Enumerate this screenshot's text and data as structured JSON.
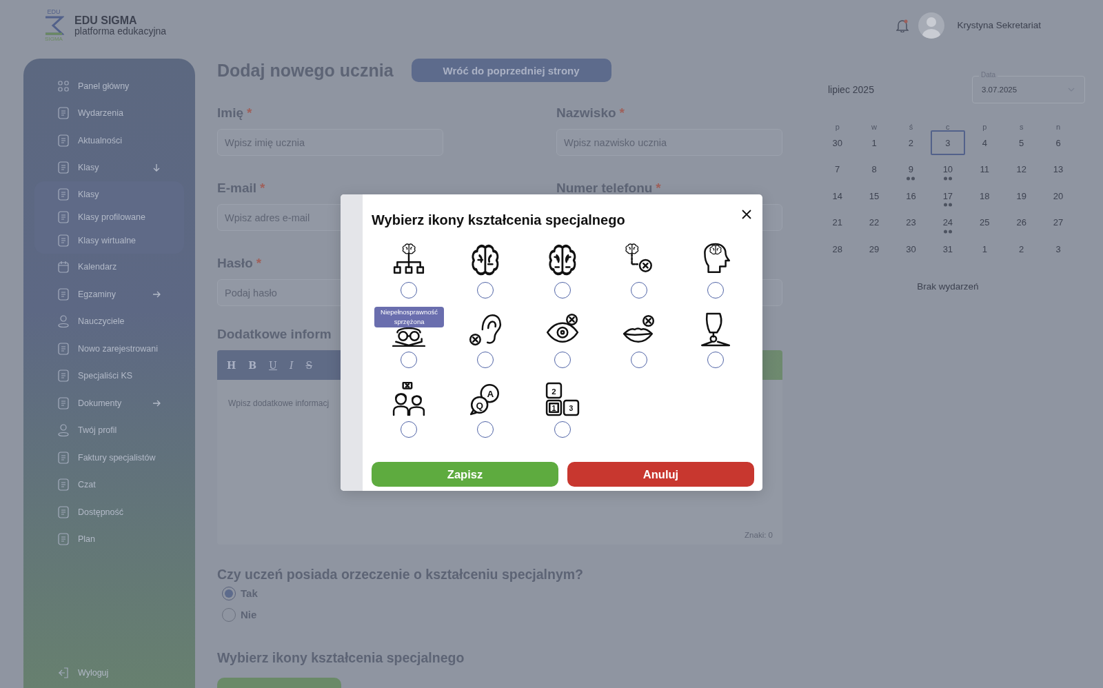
{
  "brand": {
    "logo_top": "EDU",
    "logo_bottom": "SIGMA",
    "name": "EDU SIGMA",
    "tagline": "platforma edukacyjna"
  },
  "user": {
    "name": "Krystyna Sekretariat"
  },
  "sidebar": {
    "items": [
      {
        "label": "Panel główny",
        "kind": "grid"
      },
      {
        "label": "Wydarzenia",
        "kind": "doc"
      },
      {
        "label": "Aktualności",
        "kind": "doc"
      },
      {
        "label": "Klasy",
        "kind": "doc",
        "expanded": true,
        "children": [
          {
            "label": "Klasy",
            "kind": "doc"
          },
          {
            "label": "Klasy profilowane",
            "kind": "doc"
          },
          {
            "label": "Klasy wirtualne",
            "kind": "doc"
          }
        ]
      },
      {
        "label": "Kalendarz",
        "kind": "calendar"
      },
      {
        "label": "Egzaminy",
        "kind": "doc",
        "expanded": false
      },
      {
        "label": "Nauczyciele",
        "kind": "person"
      },
      {
        "label": "Nowo zarejestrowani",
        "kind": "doc"
      },
      {
        "label": "Specjaliści KS",
        "kind": "doc"
      },
      {
        "label": "Dokumenty",
        "kind": "doc",
        "expanded": false
      },
      {
        "label": "Twój profil",
        "kind": "person"
      },
      {
        "label": "Faktury specjalistów",
        "kind": "doc"
      },
      {
        "label": "Czat",
        "kind": "doc"
      },
      {
        "label": "Dostępność",
        "kind": "doc"
      },
      {
        "label": "Plan",
        "kind": "doc"
      }
    ],
    "logout": {
      "label": "Wyloguj"
    }
  },
  "page": {
    "title": "Dodaj nowego ucznia",
    "back_button": "Wróć do poprzedniej strony",
    "fields": [
      {
        "label": "Imię",
        "required": true,
        "placeholder": "Wpisz imię ucznia"
      },
      {
        "label": "Nazwisko",
        "required": true,
        "placeholder": "Wpisz nazwisko ucznia"
      },
      {
        "label": "E-mail",
        "required": true,
        "placeholder": "Wpisz adres e-mail"
      },
      {
        "label": "Numer telefonu",
        "required": true
      },
      {
        "label": "Hasło",
        "required": true,
        "placeholder": "Podaj hasło"
      }
    ],
    "required_mark": "*",
    "editor": {
      "label": "Dodatkowe inform",
      "tools": [
        {
          "label": "H",
          "kind": "heading"
        },
        {
          "label": "B",
          "kind": "bold"
        },
        {
          "label": "U",
          "kind": "underline"
        },
        {
          "label": "I",
          "kind": "italic"
        },
        {
          "label": "S",
          "kind": "strike"
        }
      ],
      "placeholder": "Wpisz dodatkowe informacj",
      "counter": "Znaki: 0"
    },
    "question": "Czy uczeń posiada orzeczenie o kształceniu specjalnym?",
    "options": [
      {
        "label": "Tak",
        "selected": true
      },
      {
        "label": "Nie",
        "selected": false
      }
    ],
    "icons_heading": "Wybierz ikony kształcenia specjalnego"
  },
  "calendar": {
    "month": "lipiec 2025",
    "date_field": {
      "label": "Data",
      "value": "3.07.2025"
    },
    "weekdays": [
      "p",
      "w",
      "ś",
      "c",
      "p",
      "s",
      "n"
    ],
    "weeks": [
      [
        {
          "label": "30",
          "selected": false,
          "has_events": false
        },
        {
          "label": "1",
          "selected": false,
          "has_events": false
        },
        {
          "label": "2",
          "selected": false,
          "has_events": false
        },
        {
          "label": "3",
          "selected": true,
          "has_events": false
        },
        {
          "label": "4",
          "selected": false,
          "has_events": false
        },
        {
          "label": "5",
          "selected": false,
          "has_events": false
        },
        {
          "label": "6",
          "selected": false,
          "has_events": false
        }
      ],
      [
        {
          "label": "7",
          "selected": false,
          "has_events": false
        },
        {
          "label": "8",
          "selected": false,
          "has_events": false
        },
        {
          "label": "9",
          "selected": false,
          "has_events": true
        },
        {
          "label": "10",
          "selected": false,
          "has_events": true
        },
        {
          "label": "11",
          "selected": false,
          "has_events": false
        },
        {
          "label": "12",
          "selected": false,
          "has_events": false
        },
        {
          "label": "13",
          "selected": false,
          "has_events": false
        }
      ],
      [
        {
          "label": "14",
          "selected": false,
          "has_events": false
        },
        {
          "label": "15",
          "selected": false,
          "has_events": false
        },
        {
          "label": "16",
          "selected": false,
          "has_events": false
        },
        {
          "label": "17",
          "selected": false,
          "has_events": true
        },
        {
          "label": "18",
          "selected": false,
          "has_events": false
        },
        {
          "label": "19",
          "selected": false,
          "has_events": false
        },
        {
          "label": "20",
          "selected": false,
          "has_events": false
        }
      ],
      [
        {
          "label": "21",
          "selected": false,
          "has_events": false
        },
        {
          "label": "22",
          "selected": false,
          "has_events": false
        },
        {
          "label": "23",
          "selected": false,
          "has_events": false
        },
        {
          "label": "24",
          "selected": false,
          "has_events": true
        },
        {
          "label": "25",
          "selected": false,
          "has_events": false
        },
        {
          "label": "26",
          "selected": false,
          "has_events": false
        },
        {
          "label": "27",
          "selected": false,
          "has_events": false
        }
      ],
      [
        {
          "label": "28",
          "selected": false,
          "has_events": false
        },
        {
          "label": "29",
          "selected": false,
          "has_events": false
        },
        {
          "label": "30",
          "selected": false,
          "has_events": false
        },
        {
          "label": "31",
          "selected": false,
          "has_events": false
        },
        {
          "label": "1",
          "selected": false,
          "has_events": false
        },
        {
          "label": "2",
          "selected": false,
          "has_events": false
        },
        {
          "label": "3",
          "selected": false,
          "has_events": false
        }
      ]
    ],
    "empty_text": "Brak wydarzeń"
  },
  "modal": {
    "title": "Wybierz ikony kształcenia specjalnego",
    "icons": [
      {
        "kind": "brain-network",
        "selected": false
      },
      {
        "kind": "brain-puzzle",
        "selected": false
      },
      {
        "kind": "brain",
        "selected": false
      },
      {
        "kind": "brain-cross",
        "selected": false
      },
      {
        "kind": "head-brain",
        "selected": false
      },
      {
        "kind": "glasses-book",
        "selected": false,
        "tooltip": "Niepełnosprawność sprzężona"
      },
      {
        "kind": "ear-cross",
        "selected": false
      },
      {
        "kind": "eye-cross",
        "selected": false
      },
      {
        "kind": "lips-cross",
        "selected": false
      },
      {
        "kind": "prosthetic-leg",
        "selected": false
      },
      {
        "kind": "two-people",
        "selected": false
      },
      {
        "kind": "qa-bubbles",
        "selected": false,
        "glyphs": [
          "Q",
          "A"
        ]
      },
      {
        "kind": "number-blocks",
        "selected": false,
        "glyphs": [
          "2",
          "1",
          "3"
        ]
      }
    ],
    "save": "Zapisz",
    "cancel": "Anuluj"
  }
}
